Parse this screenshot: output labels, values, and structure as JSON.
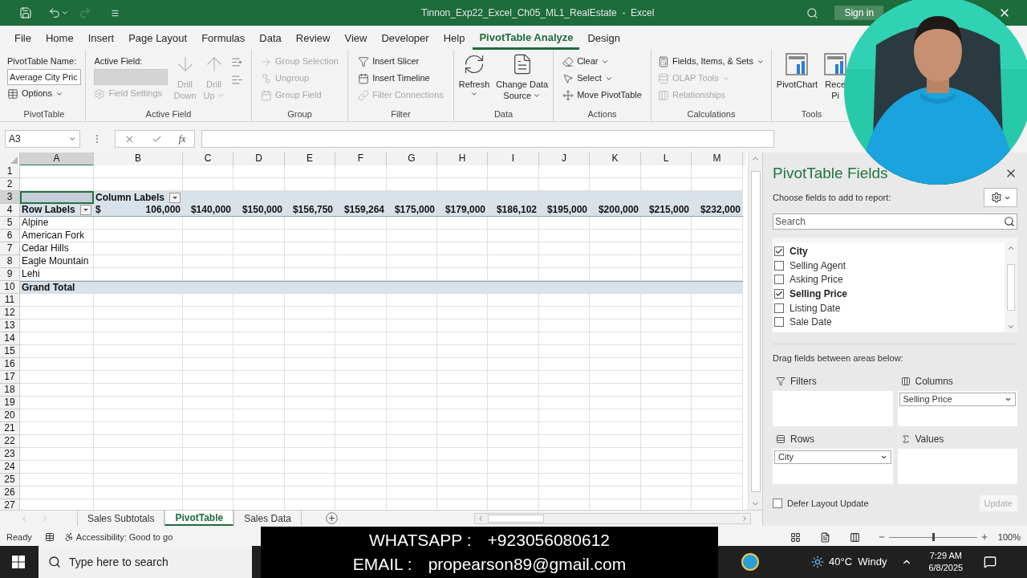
{
  "window": {
    "title": "Tinnon_Exp22_Excel_Ch05_ML1_RealEstate  -  Excel",
    "sign_in": "Sign in"
  },
  "tabs": [
    {
      "label": "File",
      "selected": false
    },
    {
      "label": "Home",
      "selected": false
    },
    {
      "label": "Insert",
      "selected": false
    },
    {
      "label": "Page Layout",
      "selected": false
    },
    {
      "label": "Formulas",
      "selected": false
    },
    {
      "label": "Data",
      "selected": false
    },
    {
      "label": "Review",
      "selected": false
    },
    {
      "label": "View",
      "selected": false
    },
    {
      "label": "Developer",
      "selected": false
    },
    {
      "label": "Help",
      "selected": false
    },
    {
      "label": "PivotTable Analyze",
      "selected": true
    },
    {
      "label": "Design",
      "selected": false
    }
  ],
  "ribbon": [
    {
      "label": "PivotTable",
      "columns": [
        {
          "items": [
            {
              "kind": "label",
              "label": "PivotTable Name:"
            },
            {
              "kind": "field",
              "value": "Average City Pric",
              "disabled": false
            },
            {
              "kind": "small",
              "label": "Options",
              "disabled": false,
              "caret": true
            }
          ]
        }
      ]
    },
    {
      "label": "Active Field",
      "columns": [
        {
          "items": [
            {
              "kind": "label",
              "label": "Active Field:"
            },
            {
              "kind": "field",
              "value": "",
              "disabled": true
            },
            {
              "kind": "small",
              "label": "Field Settings",
              "disabled": true,
              "caret": false
            }
          ]
        },
        {
          "items": [
            {
              "kind": "large",
              "lines": [
                "Drill",
                "Down"
              ],
              "disabled": true,
              "caret": false
            }
          ]
        },
        {
          "items": [
            {
              "kind": "large",
              "lines": [
                "Drill",
                "Up"
              ],
              "disabled": true,
              "caret": true
            }
          ]
        },
        {
          "items": [
            {
              "kind": "icon",
              "disabled": false
            },
            {
              "kind": "icon",
              "disabled": false
            }
          ]
        }
      ]
    },
    {
      "label": "Group",
      "columns": [
        {
          "items": [
            {
              "kind": "small",
              "label": "Group Selection",
              "disabled": true,
              "caret": false
            },
            {
              "kind": "small",
              "label": "Ungroup",
              "disabled": true,
              "caret": false
            },
            {
              "kind": "small",
              "label": "Group Field",
              "disabled": true,
              "caret": false
            }
          ]
        }
      ]
    },
    {
      "label": "Filter",
      "columns": [
        {
          "items": [
            {
              "kind": "small",
              "label": "Insert Slicer",
              "disabled": false,
              "caret": false
            },
            {
              "kind": "small",
              "label": "Insert Timeline",
              "disabled": false,
              "caret": false
            },
            {
              "kind": "small",
              "label": "Filter Connections",
              "disabled": true,
              "caret": false
            }
          ]
        }
      ]
    },
    {
      "label": "Data",
      "columns": [
        {
          "items": [
            {
              "kind": "large",
              "lines": [
                "Refresh"
              ],
              "disabled": false,
              "caret": true
            }
          ]
        },
        {
          "items": [
            {
              "kind": "large",
              "lines": [
                "Change Data",
                "Source"
              ],
              "disabled": false,
              "caret": true
            }
          ]
        }
      ]
    },
    {
      "label": "Actions",
      "columns": [
        {
          "items": [
            {
              "kind": "small",
              "label": "Clear",
              "disabled": false,
              "caret": true
            },
            {
              "kind": "small",
              "label": "Select",
              "disabled": false,
              "caret": true
            },
            {
              "kind": "small",
              "label": "Move PivotTable",
              "disabled": false,
              "caret": false
            }
          ]
        }
      ]
    },
    {
      "label": "Calculations",
      "columns": [
        {
          "items": [
            {
              "kind": "small",
              "label": "Fields, Items, & Sets",
              "disabled": false,
              "caret": true
            },
            {
              "kind": "small",
              "label": "OLAP Tools",
              "disabled": true,
              "caret": true
            },
            {
              "kind": "small",
              "label": "Relationships",
              "disabled": true,
              "caret": false
            }
          ]
        }
      ]
    },
    {
      "label": "Tools",
      "columns": [
        {
          "items": [
            {
              "kind": "large",
              "lines": [
                "PivotChart"
              ],
              "disabled": false,
              "caret": false
            }
          ]
        },
        {
          "items": [
            {
              "kind": "large",
              "lines": [
                "Rece",
                "Pi"
              ],
              "disabled": false,
              "caret": false
            }
          ]
        }
      ]
    }
  ],
  "formula_bar": {
    "name_box": "A3",
    "function_label": "fx"
  },
  "sheet": {
    "columns": [
      {
        "label": "A",
        "selected": true
      },
      {
        "label": "B",
        "selected": false
      },
      {
        "label": "C",
        "selected": false
      },
      {
        "label": "D",
        "selected": false
      },
      {
        "label": "E",
        "selected": false
      },
      {
        "label": "F",
        "selected": false
      },
      {
        "label": "G",
        "selected": false
      },
      {
        "label": "H",
        "selected": false
      },
      {
        "label": "I",
        "selected": false
      },
      {
        "label": "J",
        "selected": false
      },
      {
        "label": "K",
        "selected": false
      },
      {
        "label": "L",
        "selected": false
      },
      {
        "label": "M",
        "selected": false
      }
    ],
    "rows": [
      {
        "number": "1",
        "kind": "blank",
        "selected": false
      },
      {
        "number": "2",
        "kind": "blank",
        "selected": false
      },
      {
        "number": "3",
        "kind": "band",
        "selected": true,
        "cells": [
          {
            "text": "",
            "selected": true
          },
          {
            "text": "Column Labels",
            "filter": true,
            "selected": false
          }
        ]
      },
      {
        "number": "4",
        "kind": "header",
        "selected": false,
        "cells": [
          {
            "text": "Row Labels",
            "filter": true
          },
          {
            "currency": "$",
            "text": "106,000"
          },
          {
            "text": "$140,000"
          },
          {
            "text": "$150,000"
          },
          {
            "text": "$156,750"
          },
          {
            "text": "$159,264"
          },
          {
            "text": "$175,000"
          },
          {
            "text": "$179,000"
          },
          {
            "text": "$186,102"
          },
          {
            "text": "$195,000"
          },
          {
            "text": "$200,000"
          },
          {
            "text": "$215,000"
          },
          {
            "text": "$232,000"
          }
        ]
      },
      {
        "number": "5",
        "kind": "item",
        "selected": false,
        "cells": [
          {
            "text": "Alpine"
          }
        ]
      },
      {
        "number": "6",
        "kind": "item",
        "selected": false,
        "cells": [
          {
            "text": "American Fork"
          }
        ]
      },
      {
        "number": "7",
        "kind": "item",
        "selected": false,
        "cells": [
          {
            "text": "Cedar Hills"
          }
        ]
      },
      {
        "number": "8",
        "kind": "item",
        "selected": false,
        "cells": [
          {
            "text": "Eagle Mountain"
          }
        ]
      },
      {
        "number": "9",
        "kind": "item",
        "selected": false,
        "cells": [
          {
            "text": "Lehi"
          }
        ]
      },
      {
        "number": "10",
        "kind": "total",
        "selected": false,
        "cells": [
          {
            "text": "Grand Total"
          }
        ]
      },
      {
        "number": "11",
        "kind": "blank",
        "selected": false
      },
      {
        "number": "12",
        "kind": "blank",
        "selected": false
      },
      {
        "number": "13",
        "kind": "blank",
        "selected": false
      },
      {
        "number": "14",
        "kind": "blank",
        "selected": false
      },
      {
        "number": "15",
        "kind": "blank",
        "selected": false
      },
      {
        "number": "16",
        "kind": "blank",
        "selected": false
      },
      {
        "number": "17",
        "kind": "blank",
        "selected": false
      },
      {
        "number": "18",
        "kind": "blank",
        "selected": false
      },
      {
        "number": "19",
        "kind": "blank",
        "selected": false
      },
      {
        "number": "20",
        "kind": "blank",
        "selected": false
      },
      {
        "number": "21",
        "kind": "blank",
        "selected": false
      },
      {
        "number": "22",
        "kind": "blank",
        "selected": false
      },
      {
        "number": "23",
        "kind": "blank",
        "selected": false
      },
      {
        "number": "24",
        "kind": "blank",
        "selected": false
      },
      {
        "number": "25",
        "kind": "blank",
        "selected": false
      },
      {
        "number": "26",
        "kind": "blank",
        "selected": false
      },
      {
        "number": "27",
        "kind": "blank",
        "selected": false
      }
    ]
  },
  "sheet_tabs": [
    {
      "label": "Sales Subtotals",
      "selected": false
    },
    {
      "label": "PivotTable",
      "selected": true
    },
    {
      "label": "Sales Data",
      "selected": false
    }
  ],
  "pane": {
    "title": "PivotTable Fields",
    "subtitle": "Choose fields to add to report:",
    "search": {
      "placeholder": "Search"
    },
    "fields": [
      {
        "label": "City",
        "checked": true
      },
      {
        "label": "Selling Agent",
        "checked": false
      },
      {
        "label": "Asking Price",
        "checked": false
      },
      {
        "label": "Selling Price",
        "checked": true
      },
      {
        "label": "Listing Date",
        "checked": false
      },
      {
        "label": "Sale Date",
        "checked": false
      }
    ],
    "drag_hint": "Drag fields between areas below:",
    "areas": [
      {
        "kind": "filters",
        "label": "Filters"
      },
      {
        "kind": "columns",
        "label": "Columns",
        "fields": [
          "Selling Price"
        ]
      },
      {
        "kind": "rows",
        "label": "Rows",
        "fields": [
          "City"
        ]
      },
      {
        "kind": "values",
        "label": "Values"
      }
    ],
    "defer": {
      "label": "Defer Layout Update",
      "checked": false
    },
    "update": {
      "label": "Update",
      "disabled": true
    }
  },
  "status_bar": {
    "mode": "Ready",
    "accessibility": "Accessibility: Good to go",
    "zoom": {
      "level": 0.5,
      "label": "100%"
    }
  },
  "taskbar": {
    "search": {
      "placeholder": "Type here to search"
    },
    "weather": "40°C  Windy",
    "time": "7:29 AM",
    "date": "6/8/2025"
  },
  "caption": [
    {
      "label": "WHATSAPP :",
      "value": "+923056080612"
    },
    {
      "label": "EMAIL :",
      "value": "propearson89@gmail.com"
    }
  ]
}
